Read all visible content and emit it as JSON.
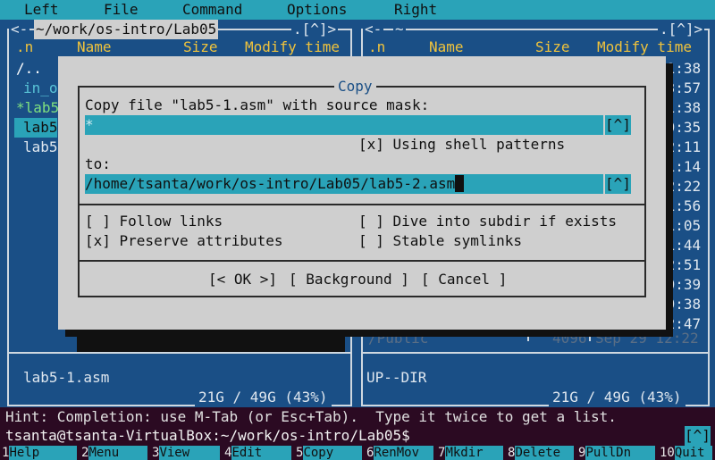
{
  "menu": [
    "Left",
    "File",
    "Command",
    "Options",
    "Right"
  ],
  "left_panel": {
    "path": "~/work/os-intro/Lab05",
    "corner": ".[^]>",
    "left_marker": "<-",
    "columns": [
      ".n",
      "Name",
      "Size",
      "Modify time"
    ],
    "rows": [
      "/..",
      "in_o",
      "*lab5",
      "lab5",
      "lab5"
    ],
    "footer_name": "lab5-1.asm",
    "disk": "21G / 49G (43%)"
  },
  "right_panel": {
    "path": "~",
    "corner": ".[^]>",
    "left_marker": "<-",
    "columns": [
      ".n",
      "Name",
      "Size",
      "Modify time"
    ],
    "times": [
      "11:38",
      "23:57",
      "11:38",
      "10:35",
      "22:11",
      "01:14",
      "12:22",
      "21:56",
      "11:05",
      "11:44",
      "12:51",
      "20:39",
      "19:38",
      "22:47"
    ],
    "last_row": {
      "name": "/Public",
      "size": "4096",
      "date": "Sep 29 12:22"
    },
    "footer_name": "UP--DIR",
    "disk": "21G / 49G (43%)"
  },
  "dialog": {
    "title": "Copy",
    "source_label": "Copy file \"lab5-1.asm\" with source mask:",
    "source_value": "*",
    "history_btn": "[^]",
    "shell_patterns": "[x] Using shell patterns",
    "to_label": "to:",
    "to_value": "/home/tsanta/work/os-intro/Lab05/lab5-2.asm",
    "follow_links": "[ ] Follow links",
    "dive_subdir": "[ ] Dive into subdir if exists",
    "preserve_attrs": "[x] Preserve attributes",
    "stable_symlinks": "[ ] Stable symlinks",
    "ok": "[< OK >]",
    "background": "[ Background ]",
    "cancel": "[ Cancel ]"
  },
  "hint": "Hint: Completion: use M-Tab (or Esc+Tab).  Type it twice to get a list.",
  "prompt": "tsanta@tsanta-VirtualBox:~/work/os-intro/Lab05$",
  "prompt_btn": "[^]",
  "keybar": [
    {
      "num": "1",
      "label": "Help"
    },
    {
      "num": "2",
      "label": "Menu"
    },
    {
      "num": "3",
      "label": "View"
    },
    {
      "num": "4",
      "label": "Edit"
    },
    {
      "num": "5",
      "label": "Copy"
    },
    {
      "num": "6",
      "label": "RenMov"
    },
    {
      "num": "7",
      "label": "Mkdir"
    },
    {
      "num": "8",
      "label": "Delete"
    },
    {
      "num": "9",
      "label": "PullDn"
    },
    {
      "num": "10",
      "label": "Quit"
    }
  ],
  "colors": {
    "menu_bg": "#2aa3b8",
    "panel_bg": "#1a4f86",
    "dialog_bg": "#cfcfcf",
    "header_fg": "#f0c33c",
    "terminal_bg": "#2b0a22"
  }
}
